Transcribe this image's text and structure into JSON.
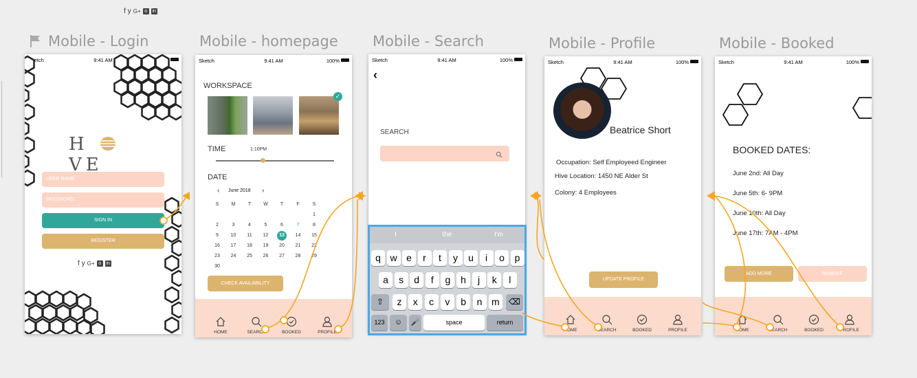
{
  "top_social": [
    "f",
    "y",
    "G+",
    "o",
    "in"
  ],
  "artboards": {
    "login": "Mobile - Login",
    "homepage": "Mobile - homepage",
    "search": "Mobile - Search",
    "profile": "Mobile - Profile",
    "booked": "Mobile - Booked"
  },
  "status": {
    "carrier": "Sketch",
    "time": "9:41 AM",
    "battery": "100%"
  },
  "login": {
    "logo_left": "H",
    "logo_right": "VE",
    "username_placeholder": "USER NAME",
    "password_placeholder": "PASSWORD",
    "signin": "SIGN IN",
    "register": "REGISTER",
    "social": [
      "f",
      "y",
      "G+",
      "o",
      "in"
    ]
  },
  "home": {
    "workspace": "WORKSPACE",
    "time": "TIME",
    "time_value": "1:10PM",
    "time_fraction": 0.4,
    "date": "DATE",
    "month": "June 2018",
    "weekdays": [
      "S",
      "M",
      "T",
      "W",
      "T",
      "F",
      "S"
    ],
    "weeks": [
      [
        "",
        "",
        "",
        "",
        "",
        "",
        "1"
      ],
      [
        "2",
        "3",
        "4",
        "5",
        "6",
        "7",
        "8"
      ],
      [
        "9",
        "10",
        "11",
        "12",
        "13",
        "14",
        "15"
      ],
      [
        "16",
        "17",
        "18",
        "19",
        "20",
        "21",
        "22"
      ],
      [
        "23",
        "24",
        "25",
        "26",
        "27",
        "28",
        "29"
      ],
      [
        "30",
        "",
        "",
        "",
        "",
        "",
        ""
      ]
    ],
    "selected_day": "13",
    "check": "CHECK AVAILABILITY"
  },
  "tabs": {
    "home": "HOME",
    "search": "SEARCH",
    "booked": "BOOKED",
    "profile": "PROFILE"
  },
  "search": {
    "label": "SEARCH",
    "placeholder": "",
    "suggestions": [
      "I",
      "the",
      "I'm"
    ],
    "row1": [
      "q",
      "w",
      "e",
      "r",
      "t",
      "y",
      "u",
      "i",
      "o",
      "p"
    ],
    "row2": [
      "a",
      "s",
      "d",
      "f",
      "g",
      "h",
      "j",
      "k",
      "l"
    ],
    "row3": [
      "z",
      "x",
      "c",
      "v",
      "b",
      "n",
      "m"
    ],
    "k123": "123",
    "space": "space",
    "return": "return"
  },
  "profile": {
    "name": "Beatrice Short",
    "occupation": "Occupation: Self Employeed Engineer",
    "location": "Hive Location: 1450 NE Alder St",
    "colony": "Colony: 4 Employees",
    "update": "UPDATE PROFILE"
  },
  "booked": {
    "title": "BOOKED DATES:",
    "dates": [
      "June 2nd: All Day",
      "June 5th: 6- 9PM",
      "June 10th: All Day",
      "June 17th: 7AM - 4PM"
    ],
    "add": "ADD MORE",
    "remove": "REMOVE"
  },
  "colors": {
    "peach": "#fcd5c6",
    "teal": "#2fa89a",
    "gold": "#dcb46e",
    "orange_link": "#f5a623",
    "keyboard_border": "#4aa8e8"
  }
}
